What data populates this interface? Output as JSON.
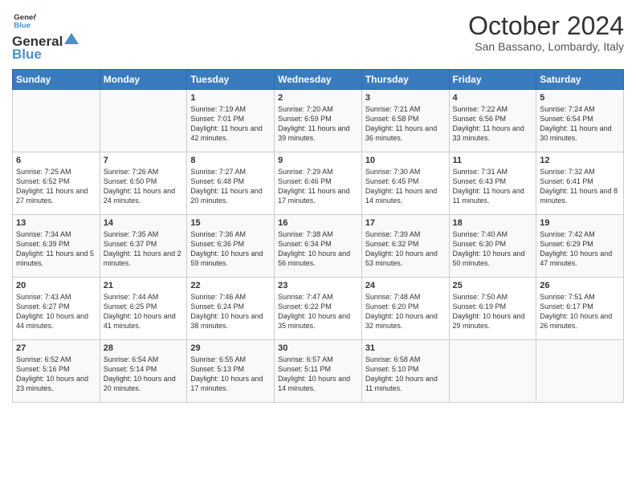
{
  "header": {
    "logo_line1": "General",
    "logo_line2": "Blue",
    "month": "October 2024",
    "location": "San Bassano, Lombardy, Italy"
  },
  "days_of_week": [
    "Sunday",
    "Monday",
    "Tuesday",
    "Wednesday",
    "Thursday",
    "Friday",
    "Saturday"
  ],
  "weeks": [
    [
      {
        "day": "",
        "content": ""
      },
      {
        "day": "",
        "content": ""
      },
      {
        "day": "1",
        "content": "Sunrise: 7:19 AM\nSunset: 7:01 PM\nDaylight: 11 hours and 42 minutes."
      },
      {
        "day": "2",
        "content": "Sunrise: 7:20 AM\nSunset: 6:59 PM\nDaylight: 11 hours and 39 minutes."
      },
      {
        "day": "3",
        "content": "Sunrise: 7:21 AM\nSunset: 6:58 PM\nDaylight: 11 hours and 36 minutes."
      },
      {
        "day": "4",
        "content": "Sunrise: 7:22 AM\nSunset: 6:56 PM\nDaylight: 11 hours and 33 minutes."
      },
      {
        "day": "5",
        "content": "Sunrise: 7:24 AM\nSunset: 6:54 PM\nDaylight: 11 hours and 30 minutes."
      }
    ],
    [
      {
        "day": "6",
        "content": "Sunrise: 7:25 AM\nSunset: 6:52 PM\nDaylight: 11 hours and 27 minutes."
      },
      {
        "day": "7",
        "content": "Sunrise: 7:26 AM\nSunset: 6:50 PM\nDaylight: 11 hours and 24 minutes."
      },
      {
        "day": "8",
        "content": "Sunrise: 7:27 AM\nSunset: 6:48 PM\nDaylight: 11 hours and 20 minutes."
      },
      {
        "day": "9",
        "content": "Sunrise: 7:29 AM\nSunset: 6:46 PM\nDaylight: 11 hours and 17 minutes."
      },
      {
        "day": "10",
        "content": "Sunrise: 7:30 AM\nSunset: 6:45 PM\nDaylight: 11 hours and 14 minutes."
      },
      {
        "day": "11",
        "content": "Sunrise: 7:31 AM\nSunset: 6:43 PM\nDaylight: 11 hours and 11 minutes."
      },
      {
        "day": "12",
        "content": "Sunrise: 7:32 AM\nSunset: 6:41 PM\nDaylight: 11 hours and 8 minutes."
      }
    ],
    [
      {
        "day": "13",
        "content": "Sunrise: 7:34 AM\nSunset: 6:39 PM\nDaylight: 11 hours and 5 minutes."
      },
      {
        "day": "14",
        "content": "Sunrise: 7:35 AM\nSunset: 6:37 PM\nDaylight: 11 hours and 2 minutes."
      },
      {
        "day": "15",
        "content": "Sunrise: 7:36 AM\nSunset: 6:36 PM\nDaylight: 10 hours and 59 minutes."
      },
      {
        "day": "16",
        "content": "Sunrise: 7:38 AM\nSunset: 6:34 PM\nDaylight: 10 hours and 56 minutes."
      },
      {
        "day": "17",
        "content": "Sunrise: 7:39 AM\nSunset: 6:32 PM\nDaylight: 10 hours and 53 minutes."
      },
      {
        "day": "18",
        "content": "Sunrise: 7:40 AM\nSunset: 6:30 PM\nDaylight: 10 hours and 50 minutes."
      },
      {
        "day": "19",
        "content": "Sunrise: 7:42 AM\nSunset: 6:29 PM\nDaylight: 10 hours and 47 minutes."
      }
    ],
    [
      {
        "day": "20",
        "content": "Sunrise: 7:43 AM\nSunset: 6:27 PM\nDaylight: 10 hours and 44 minutes."
      },
      {
        "day": "21",
        "content": "Sunrise: 7:44 AM\nSunset: 6:25 PM\nDaylight: 10 hours and 41 minutes."
      },
      {
        "day": "22",
        "content": "Sunrise: 7:46 AM\nSunset: 6:24 PM\nDaylight: 10 hours and 38 minutes."
      },
      {
        "day": "23",
        "content": "Sunrise: 7:47 AM\nSunset: 6:22 PM\nDaylight: 10 hours and 35 minutes."
      },
      {
        "day": "24",
        "content": "Sunrise: 7:48 AM\nSunset: 6:20 PM\nDaylight: 10 hours and 32 minutes."
      },
      {
        "day": "25",
        "content": "Sunrise: 7:50 AM\nSunset: 6:19 PM\nDaylight: 10 hours and 29 minutes."
      },
      {
        "day": "26",
        "content": "Sunrise: 7:51 AM\nSunset: 6:17 PM\nDaylight: 10 hours and 26 minutes."
      }
    ],
    [
      {
        "day": "27",
        "content": "Sunrise: 6:52 AM\nSunset: 5:16 PM\nDaylight: 10 hours and 23 minutes."
      },
      {
        "day": "28",
        "content": "Sunrise: 6:54 AM\nSunset: 5:14 PM\nDaylight: 10 hours and 20 minutes."
      },
      {
        "day": "29",
        "content": "Sunrise: 6:55 AM\nSunset: 5:13 PM\nDaylight: 10 hours and 17 minutes."
      },
      {
        "day": "30",
        "content": "Sunrise: 6:57 AM\nSunset: 5:11 PM\nDaylight: 10 hours and 14 minutes."
      },
      {
        "day": "31",
        "content": "Sunrise: 6:58 AM\nSunset: 5:10 PM\nDaylight: 10 hours and 11 minutes."
      },
      {
        "day": "",
        "content": ""
      },
      {
        "day": "",
        "content": ""
      }
    ]
  ]
}
